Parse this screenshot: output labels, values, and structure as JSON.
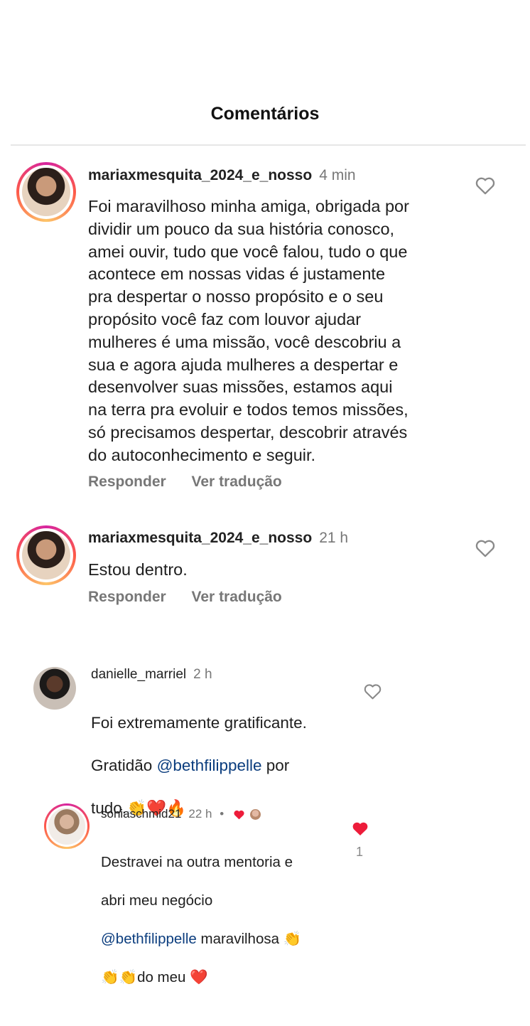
{
  "header": {
    "title": "Comentários"
  },
  "comments": [
    {
      "username": "mariaxmesquita_2024_e_nosso",
      "time": "4 min",
      "text": "Foi maravilhoso minha amiga, obrigada por\ndividir um pouco da sua  história conosco,\namei ouvir, tudo que você falou, tudo o que\nacontece em nossas vidas é justamente\npra despertar o nosso propósito e o seu\npropósito você faz com louvor ajudar\nmulheres é uma missão, você descobriu a\nsua e agora ajuda mulheres a despertar e\ndesenvolver suas missões, estamos aqui\nna terra pra evoluir e todos temos missões,\nsó precisamos despertar, descobrir através\ndo autoconhecimento e seguir.",
      "reply_label": "Responder",
      "translate_label": "Ver tradução"
    },
    {
      "username": "mariaxmesquita_2024_e_nosso",
      "time": "21 h",
      "text": "Estou dentro.",
      "reply_label": "Responder",
      "translate_label": "Ver tradução"
    },
    {
      "username": "danielle_marriel",
      "time": "2 h",
      "text_line1": "Foi extremamente gratificante.",
      "text_line2_prefix": "Gratidão ",
      "mention": "@bethfilippelle",
      "text_line2_suffix": " por",
      "text_line3": "tudo.",
      "emojis": "👏❤️🔥"
    },
    {
      "username": "soniaschmid21",
      "time": "22 h",
      "dot": "•",
      "text_line1": "Destravei na outra mentoria e",
      "text_line2": "abri meu negócio",
      "mention": "@bethfilippelle",
      "text_line3_suffix": " maravilhosa ",
      "clap": "👏",
      "text_line4_prefix": "👏👏",
      "text_line4": "do meu ",
      "heart": "❤️",
      "like_count": "1"
    }
  ],
  "colors": {
    "accent_heart": "#ed1c3a",
    "mention": "#0b3d7e",
    "muted": "#777777"
  },
  "icons": [
    "heart-outline-icon",
    "heart-filled-icon",
    "avatar"
  ]
}
